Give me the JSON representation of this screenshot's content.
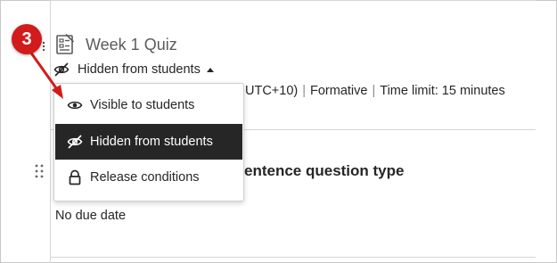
{
  "step_badge": {
    "number": "3",
    "color": "#d21b1b"
  },
  "quiz": {
    "icon": "quiz-icon",
    "title": "Week 1 Quiz",
    "visibility": {
      "icon": "eye-slash-icon",
      "label": "Hidden from students",
      "caret_icon": "caret-up-icon"
    },
    "meta": {
      "due": "UTC+10)",
      "type": "Formative",
      "time_limit": "Time limit: 15 minutes"
    }
  },
  "visibility_menu": {
    "items": [
      {
        "icon": "eye-icon",
        "label": "Visible to students",
        "selected": false
      },
      {
        "icon": "eye-slash-icon",
        "label": "Hidden from students",
        "selected": true
      },
      {
        "icon": "lock-icon",
        "label": "Release conditions",
        "selected": false
      }
    ]
  },
  "second_item": {
    "drag_icon": "drag-handle-icon",
    "title_fragment": "entence question type",
    "due_text": "No due date"
  },
  "colors": {
    "menu_selected_bg": "#262626",
    "title_gray": "#5b5b5b",
    "divider": "#d6d6d6"
  }
}
